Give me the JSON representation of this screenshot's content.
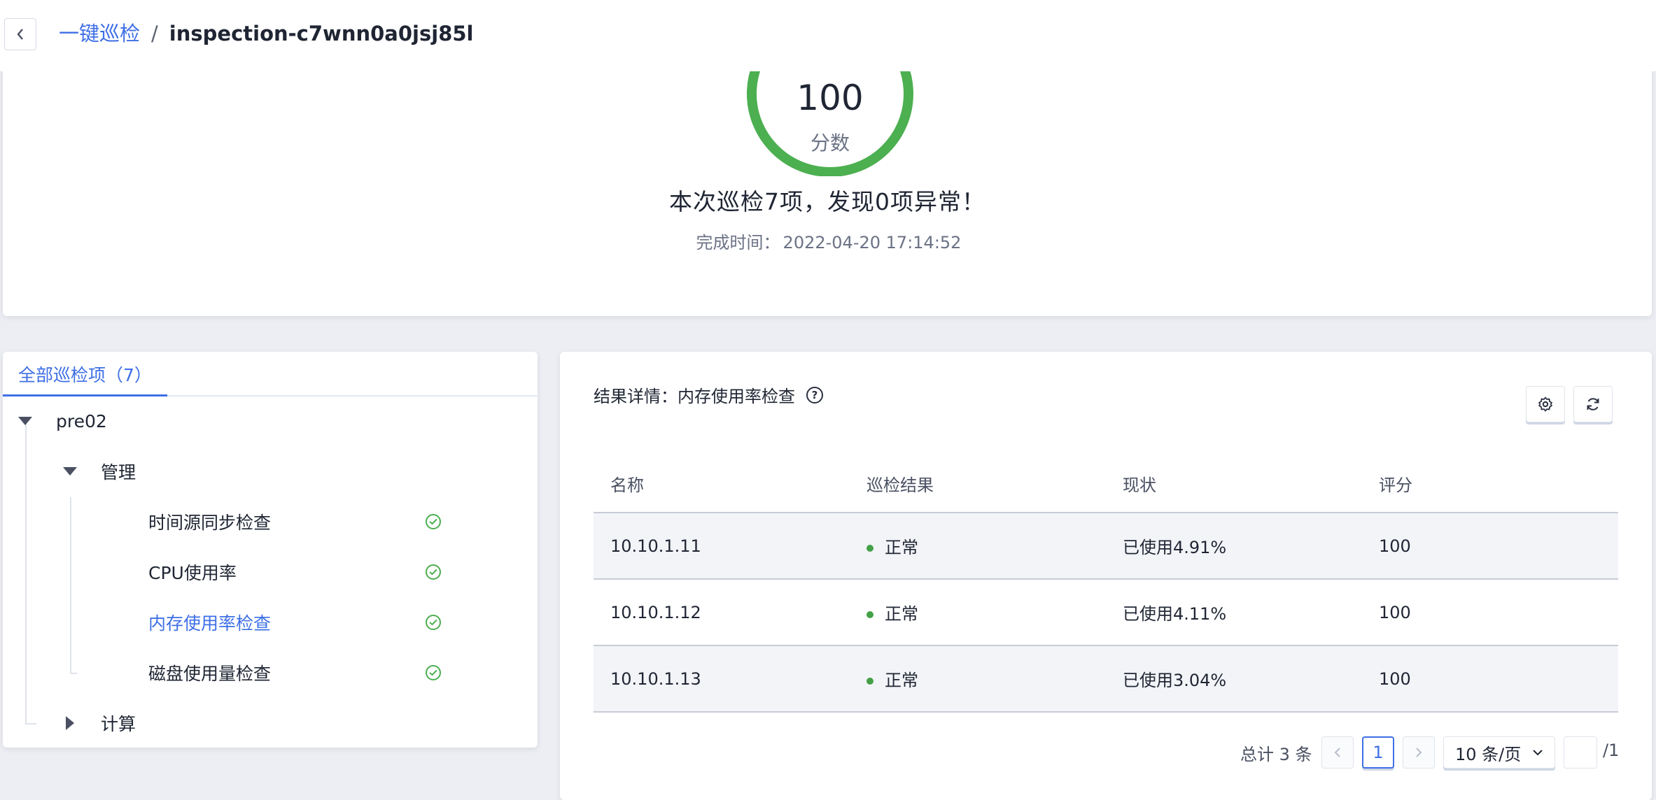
{
  "breadcrumb": {
    "parent": "一键巡检",
    "separator": "/",
    "current": "inspection-c7wnn0a0jsj85l"
  },
  "summary": {
    "score": "100",
    "score_label": "分数",
    "result_text": "本次巡检7项，发现0项异常！",
    "finish_label": "完成时间：",
    "finish_time": "2022-04-20 17:14:52",
    "gauge_color": "#4caf50"
  },
  "tree": {
    "tab_label": "全部巡检项（7）",
    "root": "pre02",
    "groups": [
      {
        "label": "管理",
        "expanded": true,
        "items": [
          {
            "label": "时间源同步检查",
            "status_icon": "check-circle-icon"
          },
          {
            "label": "CPU使用率",
            "status_icon": "check-circle-icon"
          },
          {
            "label": "内存使用率检查",
            "status_icon": "check-circle-icon",
            "active": true
          },
          {
            "label": "磁盘使用量检查",
            "status_icon": "check-circle-icon"
          }
        ]
      },
      {
        "label": "计算",
        "expanded": false
      }
    ]
  },
  "detail": {
    "title_prefix": "结果详情：",
    "title_item": "内存使用率检查",
    "toolbar_icons": [
      "gear-icon",
      "refresh-icon"
    ],
    "columns": [
      "名称",
      "巡检结果",
      "现状",
      "评分"
    ],
    "rows": [
      {
        "name": "10.10.1.11",
        "result": "正常",
        "status": "已使用4.91%",
        "score": "100"
      },
      {
        "name": "10.10.1.12",
        "result": "正常",
        "status": "已使用4.11%",
        "score": "100"
      },
      {
        "name": "10.10.1.13",
        "result": "正常",
        "status": "已使用3.04%",
        "score": "100"
      }
    ],
    "status_color": "#43a047"
  },
  "pagination": {
    "total_text": "总计 3 条",
    "current_page": "1",
    "page_size": "10 条/页",
    "jump_value": "",
    "total_pages": "/1"
  },
  "colors": {
    "accent": "#3e6fe6",
    "success": "#4caf50",
    "background": "#eceef3"
  }
}
